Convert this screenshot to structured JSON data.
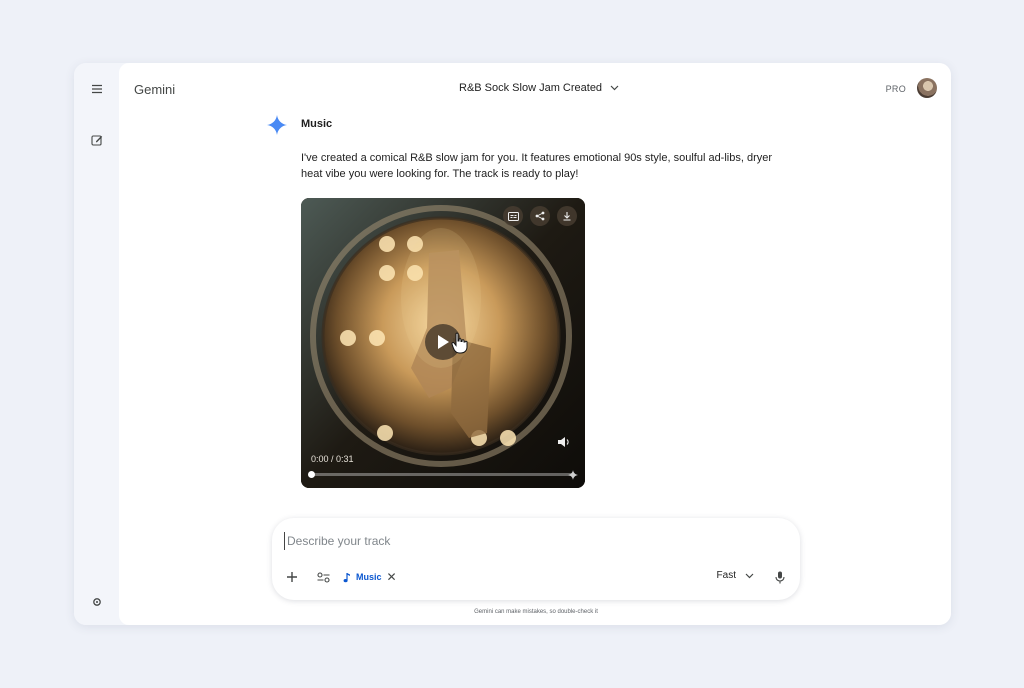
{
  "app": {
    "title": "Gemini",
    "chat_title": "R&B Sock Slow Jam Created",
    "plan_badge": "PRO"
  },
  "rail": {
    "icons": [
      "menu-icon",
      "new-chat-icon",
      "settings-icon"
    ]
  },
  "message": {
    "sender": "Music",
    "text": "I've created a comical R&B slow jam for you. It features emotional 90s style, soulful ad-libs, dryer heat vibe you were looking for. The track is ready to play!"
  },
  "player": {
    "time": "0:00 / 0:31",
    "progress": 0,
    "tools": [
      "captions-icon",
      "share-icon",
      "download-icon"
    ]
  },
  "composer": {
    "placeholder": "Describe your track",
    "value": "",
    "chip_label": "Music",
    "mode": "Fast"
  },
  "footer": {
    "disclaimer": "Gemini can make mistakes, so double-check it"
  },
  "colors": {
    "accent": "#0b57d0",
    "background": "#eef1f8",
    "spark_blue": "#4a8af4"
  }
}
